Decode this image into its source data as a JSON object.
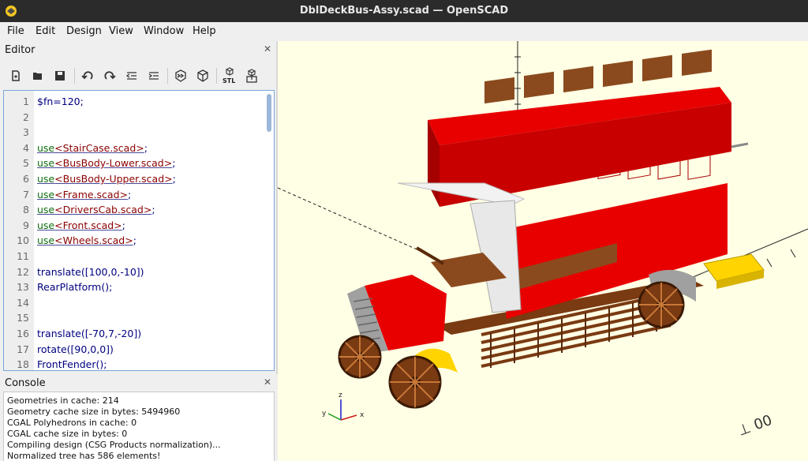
{
  "window": {
    "title": "DblDeckBus-Assy.scad — OpenSCAD"
  },
  "menu": [
    "File",
    "Edit",
    "Design",
    "View",
    "Window",
    "Help"
  ],
  "editor": {
    "title": "Editor",
    "close": "✕",
    "toolbar": [
      {
        "name": "new-icon"
      },
      {
        "name": "open-icon"
      },
      {
        "name": "save-icon"
      },
      {
        "name": "undo-icon"
      },
      {
        "name": "redo-icon"
      },
      {
        "name": "unindent-icon"
      },
      {
        "name": "indent-icon"
      },
      {
        "name": "preview-icon"
      },
      {
        "name": "render-icon"
      },
      {
        "name": "export-stl-icon"
      },
      {
        "name": "send-to-print-icon"
      }
    ],
    "stl_label": "STL",
    "lines": [
      {
        "n": "1",
        "text": "$fn=120;"
      },
      {
        "n": "2",
        "text": ""
      },
      {
        "n": "3",
        "text": ""
      },
      {
        "n": "4",
        "kw": "use",
        "arg": "<StairCase.scad>",
        "end": ";"
      },
      {
        "n": "5",
        "kw": "use",
        "arg": "<BusBody-Lower.scad>",
        "end": ";"
      },
      {
        "n": "6",
        "kw": "use",
        "arg": "<BusBody-Upper.scad>",
        "end": ";"
      },
      {
        "n": "7",
        "kw": "use",
        "arg": "<Frame.scad>",
        "end": ";"
      },
      {
        "n": "8",
        "kw": "use",
        "arg": "<DriversCab.scad>",
        "end": ";"
      },
      {
        "n": "9",
        "kw": "use",
        "arg": "<Front.scad>",
        "end": ";"
      },
      {
        "n": "10",
        "kw": "use",
        "arg": "<Wheels.scad>",
        "end": ";"
      },
      {
        "n": "11",
        "text": ""
      },
      {
        "n": "12",
        "text": "translate([100,0,-10])"
      },
      {
        "n": "13",
        "text": "RearPlatform();"
      },
      {
        "n": "14",
        "text": ""
      },
      {
        "n": "15",
        "text": ""
      },
      {
        "n": "16",
        "text": "translate([-70,7,-20])"
      },
      {
        "n": "17",
        "text": "rotate([90,0,0])"
      },
      {
        "n": "18",
        "text": "FrontFender();"
      }
    ]
  },
  "console": {
    "title": "Console",
    "close": "✕",
    "lines": [
      "Geometries in cache: 214",
      "Geometry cache size in bytes: 5494960",
      "CGAL Polyhedrons in cache: 0",
      "CGAL cache size in bytes: 0",
      "Compiling design (CSG Products normalization)...",
      "Normalized tree has 586 elements!"
    ]
  },
  "viewport": {
    "axis_labels": {
      "x": "x",
      "y": "y",
      "z": "z"
    },
    "scale_marks": "⊥ 00",
    "colors": {
      "body": "#e80000",
      "dark_red": "#a50000",
      "seat": "#8b4a1e",
      "roof": "#f2f2f2",
      "yellow": "#ffd400",
      "grey": "#a0a0a0",
      "background": "#ffffe5"
    }
  }
}
